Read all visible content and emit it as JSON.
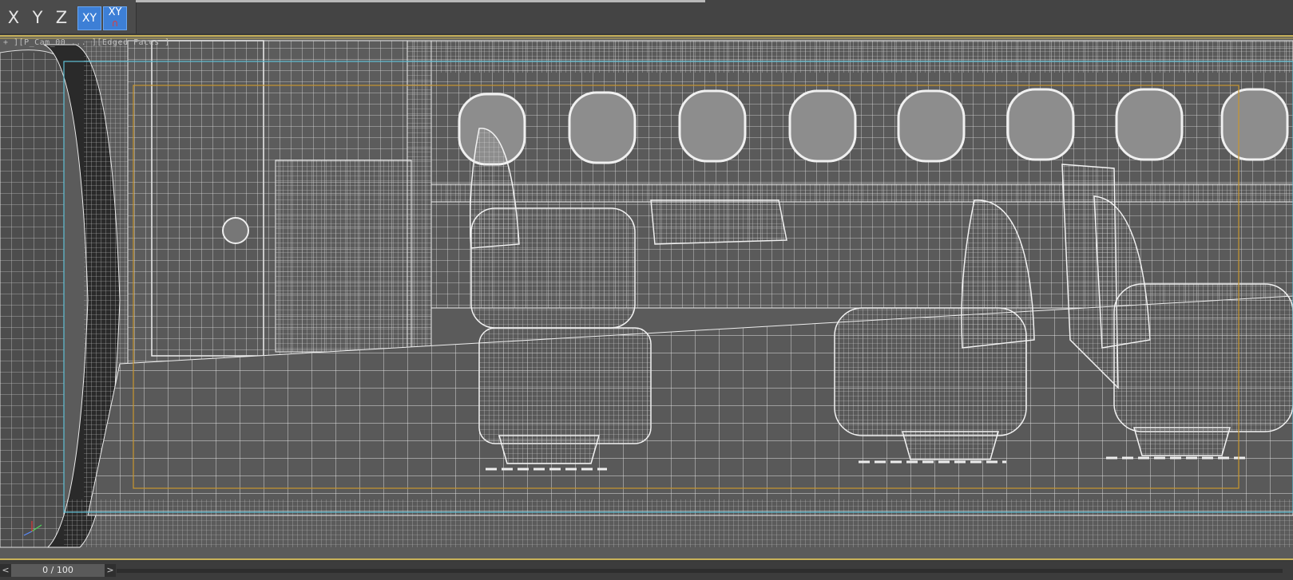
{
  "toolbar": {
    "axes": [
      {
        "label": "X",
        "name": "axis-x-button",
        "active": false
      },
      {
        "label": "Y",
        "name": "axis-y-button",
        "active": false
      },
      {
        "label": "Z",
        "name": "axis-z-button",
        "active": false
      },
      {
        "label": "XY",
        "name": "axis-xy-button",
        "active": true
      },
      {
        "label": "XY",
        "name": "axis-xy-snap-button",
        "active": true
      }
    ]
  },
  "viewport": {
    "label": "+ ][P_Cam_00 ... ][Edged Faces ]",
    "render_mode": "wireframe-edged-faces"
  },
  "timeslider": {
    "frame": "0 / 100",
    "prev_label": "<",
    "next_label": ">"
  },
  "colors": {
    "accent_active": "#3d7fd6",
    "viewport_bg": "#5b5b5b",
    "viewport_border": "#c9b35a",
    "safe_frame_orange": "#c8962e",
    "safe_frame_cyan": "#5fc0d6",
    "wire": "#e8e8e8"
  }
}
